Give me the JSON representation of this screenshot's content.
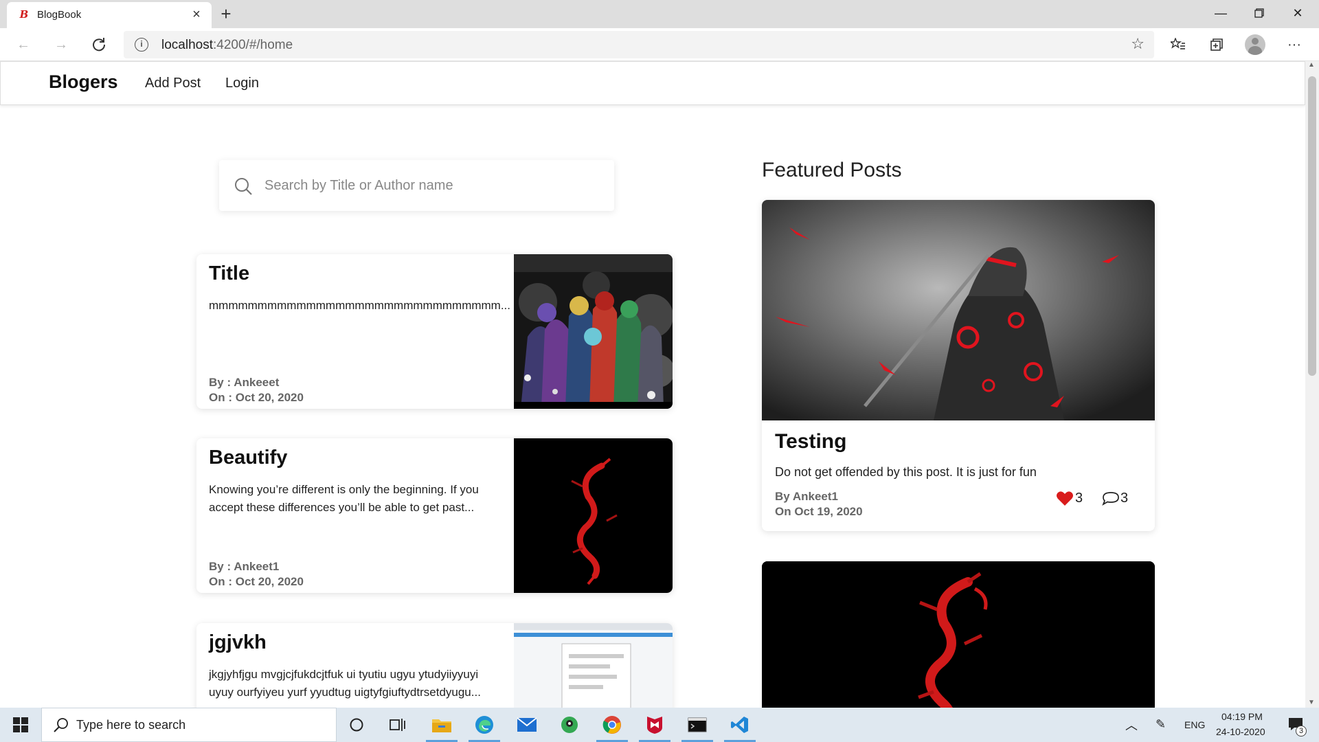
{
  "browser": {
    "tab_title": "BlogBook",
    "url_host": "localhost",
    "url_rest": ":4200/#/home"
  },
  "nav": {
    "brand": "Blogers",
    "links": [
      "Add Post",
      "Login"
    ]
  },
  "search": {
    "placeholder": "Search by Title or Author name"
  },
  "posts": [
    {
      "title": "Title",
      "description": "mmmmmmmmmmmmmmmmmmmmmmmmmmmmmm...",
      "author": "By : Ankeeet",
      "date": "On : Oct 20, 2020"
    },
    {
      "title": "Beautify",
      "description": "Knowing you’re different is only the beginning. If you accept these differences you’ll be able to get past...",
      "author": "By : Ankeet1",
      "date": "On : Oct 20, 2020"
    },
    {
      "title": "jgjvkh",
      "description": "jkgjyhfjgu mvgjcjfukdcjtfuk ui tyutiu ugyu ytudyiiyyuyi uyuy ourfyiyeu yurf yyudtug uigtyfgiuftydtrsetdyugu...",
      "author": "",
      "date": ""
    }
  ],
  "featured": {
    "heading": "Featured Posts",
    "post": {
      "title": "Testing",
      "description": "Do not get offended by this post. It is just for fun",
      "author": "By Ankeet1",
      "date": "On Oct 19, 2020",
      "likes": "3",
      "comments": "3"
    }
  },
  "taskbar": {
    "search_text": "Type here to search",
    "lang": "ENG",
    "time": "04:19 PM",
    "date": "24-10-2020",
    "notifications": "3"
  },
  "colors": {
    "accent_red": "#e0141e",
    "heart": "#d91c1c"
  }
}
